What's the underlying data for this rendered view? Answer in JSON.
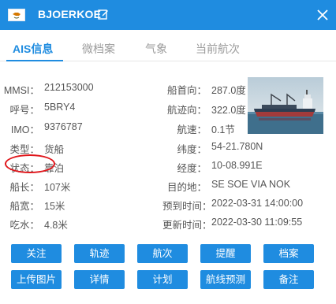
{
  "header": {
    "ship_name": "BJOERKOE",
    "flag_icon": "cyprus-flag-icon",
    "edit_icon": "edit-icon",
    "close_icon": "close-icon",
    "bg_color": "#1f8ce0"
  },
  "tabs": [
    {
      "label": "AIS信息",
      "active": true
    },
    {
      "label": "微档案",
      "active": false
    },
    {
      "label": "气象",
      "active": false
    },
    {
      "label": "当前航次",
      "active": false
    }
  ],
  "left_fields": [
    {
      "label": "MMSI：",
      "value": "212153000"
    },
    {
      "label": "呼号：",
      "value": "5BRY4"
    },
    {
      "label": "IMO：",
      "value": "9376787"
    },
    {
      "label": "类型：",
      "value": "货船"
    },
    {
      "label": "状态：",
      "value": "靠泊"
    },
    {
      "label": "船长：",
      "value": "107米"
    },
    {
      "label": "船宽：",
      "value": "15米"
    },
    {
      "label": "吃水：",
      "value": "4.8米"
    }
  ],
  "right_fields": [
    {
      "label": "船首向：",
      "value": "287.0度"
    },
    {
      "label": "航迹向：",
      "value": "322.0度"
    },
    {
      "label": "航速：",
      "value": "0.1节"
    },
    {
      "label": "纬度：",
      "value": "54-21.780N"
    },
    {
      "label": "经度：",
      "value": "10-08.991E"
    },
    {
      "label": "目的地：",
      "value": "SE SOE VIA NOK"
    },
    {
      "label": "预到时间：",
      "value": "2022-03-31 14:00:00"
    },
    {
      "label": "更新时间：",
      "value": "2022-03-30 11:09:55"
    }
  ],
  "buttons_row1": [
    "关注",
    "轨迹",
    "航次",
    "提醒",
    "档案"
  ],
  "buttons_row2": [
    "上传图片",
    "详情",
    "计划",
    "航线预测",
    "备注"
  ],
  "colors": {
    "accent": "#1f8ce0",
    "highlight": "#e0161b"
  }
}
